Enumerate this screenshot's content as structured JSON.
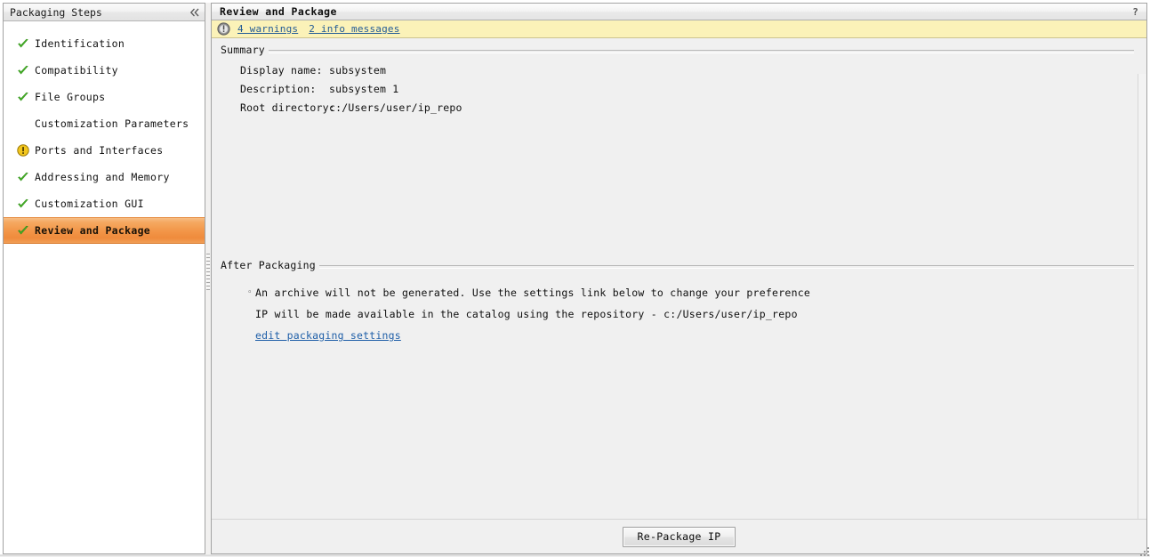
{
  "sidebar": {
    "title": "Packaging Steps",
    "collapse_icon": "chevron-double-left-icon",
    "items": [
      {
        "label": "Identification",
        "icon": "check-icon",
        "selected": false
      },
      {
        "label": "Compatibility",
        "icon": "check-icon",
        "selected": false
      },
      {
        "label": "File Groups",
        "icon": "check-icon",
        "selected": false
      },
      {
        "label": "Customization Parameters",
        "icon": "none",
        "selected": false
      },
      {
        "label": "Ports and Interfaces",
        "icon": "warning-icon",
        "selected": false
      },
      {
        "label": "Addressing and Memory",
        "icon": "check-icon",
        "selected": false
      },
      {
        "label": "Customization GUI",
        "icon": "check-icon",
        "selected": false
      },
      {
        "label": "Review and Package",
        "icon": "check-icon",
        "selected": true
      }
    ]
  },
  "panel": {
    "title": "Review and Package",
    "help_icon": "?",
    "messages": {
      "icon": "info-icon",
      "warnings_link": "4 warnings",
      "info_link": "2 info messages"
    },
    "summary": {
      "heading": "Summary",
      "fields": [
        {
          "label": "Display name:",
          "value": "subsystem"
        },
        {
          "label": "Description:",
          "value": "subsystem 1"
        },
        {
          "label": "Root directory:",
          "value": "c:/Users/user/ip_repo"
        }
      ]
    },
    "after_packaging": {
      "heading": "After Packaging",
      "bullet": "◦",
      "line1": "An archive will not be generated. Use the settings link below to change your preference",
      "line2": "IP will be made available in the catalog using the repository -  c:/Users/user/ip_repo",
      "settings_link": "edit packaging settings"
    },
    "footer": {
      "repackage_label": "Re-Package IP"
    }
  },
  "colors": {
    "selected_row": "#f29547",
    "message_bar": "#fbf2b8",
    "link": "#225b96",
    "check": "#3aa01e",
    "warning": "#f0c000",
    "panel_bg": "#f0f0f0"
  }
}
